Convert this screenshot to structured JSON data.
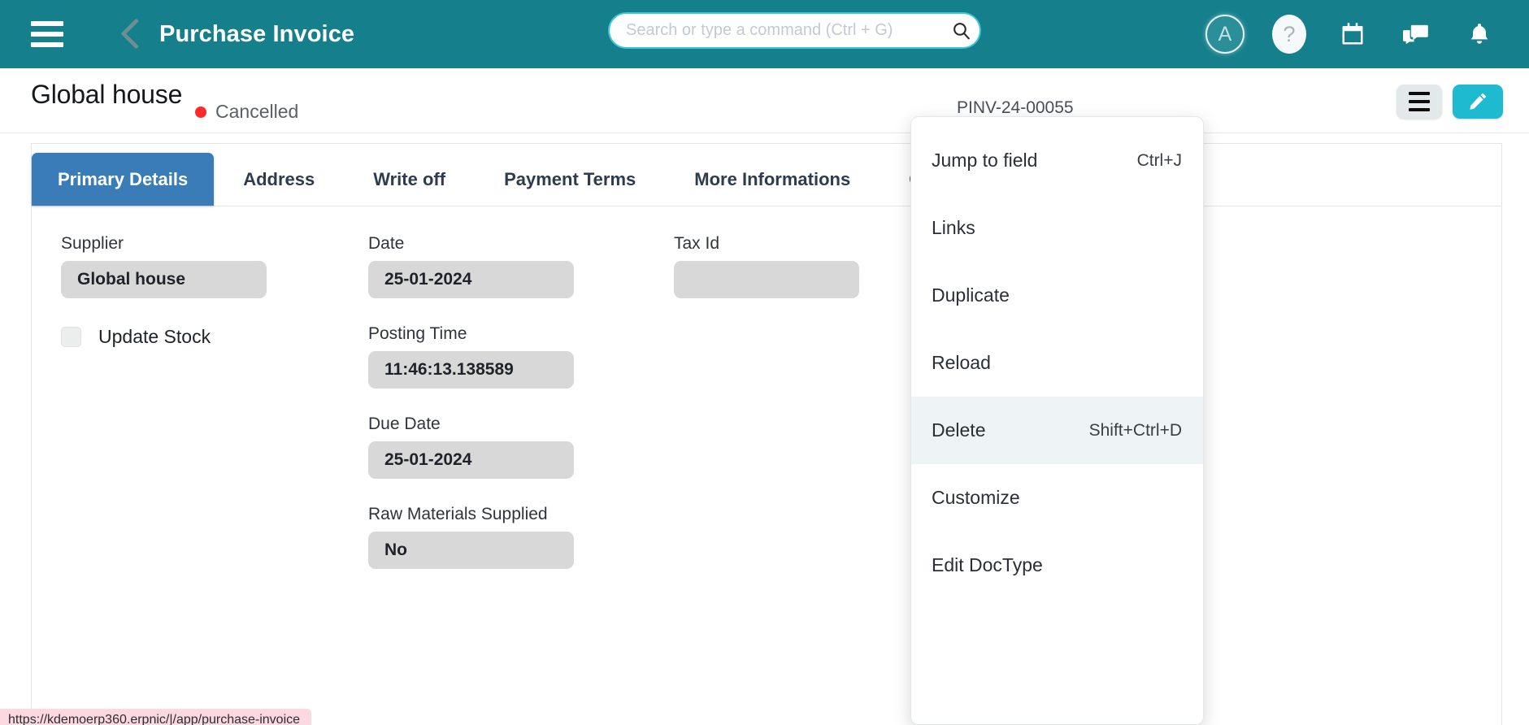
{
  "navbar": {
    "menu_icon": "hamburger-icon",
    "back_icon": "chevron-left-icon",
    "title": "Purchase Invoice",
    "search": {
      "placeholder": "Search or type a command (Ctrl + G)",
      "value": "",
      "icon": "search-icon"
    },
    "avatar_letter": "A",
    "help_label": "?",
    "icons": [
      "calendar-icon",
      "chat-icon",
      "bell-icon"
    ],
    "background": "#15808c"
  },
  "page_head": {
    "title": "Global house",
    "status": "Cancelled",
    "status_color": "#ff2b2b",
    "doc_id": "PINV-24-00055",
    "menu_button": "menu-button",
    "edit_button": "edit-button",
    "edit_button_color": "#1ebad0"
  },
  "tabs": [
    {
      "label": "Primary Details",
      "active": true
    },
    {
      "label": "Address",
      "active": false
    },
    {
      "label": "Write off",
      "active": false
    },
    {
      "label": "Payment Terms",
      "active": false
    },
    {
      "label": "More Informations",
      "active": false
    },
    {
      "label": "Overview",
      "active": false
    }
  ],
  "form": {
    "column1": [
      {
        "label": "Supplier",
        "value": "Global house"
      }
    ],
    "checkbox": {
      "label": "Update Stock",
      "checked": false
    },
    "column2": [
      {
        "label": "Date",
        "value": "25-01-2024"
      },
      {
        "label": "Posting Time",
        "value": "11:46:13.138589"
      },
      {
        "label": "Due Date",
        "value": "25-01-2024"
      },
      {
        "label": "Raw Materials Supplied",
        "value": "No"
      }
    ],
    "column3": [
      {
        "label": "Tax Id",
        "value": ""
      }
    ]
  },
  "dropdown": {
    "items": [
      {
        "label": "Jump to field",
        "shortcut": "Ctrl+J",
        "highlight": false
      },
      {
        "label": "Links",
        "shortcut": "",
        "highlight": false
      },
      {
        "label": "Duplicate",
        "shortcut": "",
        "highlight": false
      },
      {
        "label": "Reload",
        "shortcut": "",
        "highlight": false
      },
      {
        "label": "Delete",
        "shortcut": "Shift+Ctrl+D",
        "highlight": true
      },
      {
        "label": "Customize",
        "shortcut": "",
        "highlight": false
      },
      {
        "label": "Edit DocType",
        "shortcut": "",
        "highlight": false
      }
    ]
  },
  "status_bar": {
    "url": "https://kdemoerp360.erpnic/|/app/purchase-invoice"
  }
}
